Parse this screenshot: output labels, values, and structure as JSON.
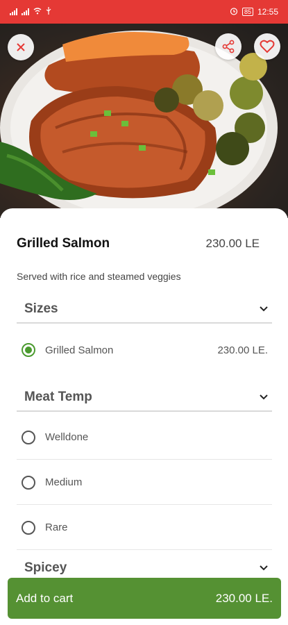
{
  "status_bar": {
    "time": "12:55",
    "battery": "85"
  },
  "item": {
    "title": "Grilled Salmon",
    "price": "230.00 LE",
    "description": "Served with rice and steamed veggies"
  },
  "sections": {
    "sizes": {
      "label": "Sizes",
      "options": [
        {
          "label": "Grilled Salmon",
          "price": "230.00  LE.",
          "selected": true
        }
      ]
    },
    "meat_temp": {
      "label": "Meat Temp",
      "options": [
        {
          "label": "Welldone",
          "selected": false
        },
        {
          "label": "Medium",
          "selected": false
        },
        {
          "label": "Rare",
          "selected": false
        }
      ]
    },
    "spicey": {
      "label": "Spicey"
    }
  },
  "cart": {
    "label": "Add to cart",
    "total": "230.00  LE."
  },
  "colors": {
    "status_bar": "#e53935",
    "accent_green": "#559133",
    "radio_selected": "#4a9a2e"
  },
  "icons": {
    "close": "close-icon",
    "share": "share-icon",
    "favorite": "heart-icon",
    "section_toggle": "chevron-down-icon"
  }
}
